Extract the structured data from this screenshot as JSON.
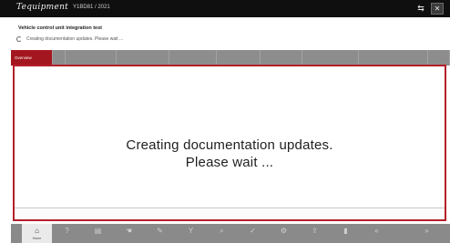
{
  "titlebar": {
    "brand": "Tequipment",
    "vin": "Y1BD81 / 2021",
    "plug_icon": "connector-icon",
    "close_label": "✕"
  },
  "page": {
    "heading": "Vehicle control unit integration test",
    "status_text": "Creating documentation updates. Please wait ..."
  },
  "tabs": [
    {
      "label": "Overview",
      "active": true
    },
    {
      "label": ""
    },
    {
      "label": ""
    },
    {
      "label": ""
    },
    {
      "label": ""
    },
    {
      "label": ""
    },
    {
      "label": ""
    },
    {
      "label": ""
    },
    {
      "label": ""
    },
    {
      "label": ""
    }
  ],
  "main": {
    "message_line1": "Creating documentation updates.",
    "message_line2": "Please wait ..."
  },
  "bottom_toolbar": {
    "items": [
      {
        "icon": "home-icon",
        "label": "Home",
        "active": true
      },
      {
        "icon": "help-icon",
        "label": ""
      },
      {
        "icon": "document-icon",
        "label": ""
      },
      {
        "icon": "hand-icon",
        "label": ""
      },
      {
        "icon": "pencil-icon",
        "label": ""
      },
      {
        "icon": "filter-icon",
        "label": ""
      },
      {
        "icon": "search-icon",
        "label": ""
      },
      {
        "icon": "check-icon",
        "label": ""
      },
      {
        "icon": "gear-icon",
        "label": ""
      },
      {
        "icon": "share-icon",
        "label": ""
      },
      {
        "icon": "print-icon",
        "label": ""
      },
      {
        "icon": "back-icon",
        "label": ""
      },
      {
        "icon": "forward-icon",
        "label": ""
      }
    ]
  },
  "colors": {
    "accent": "#a4161f",
    "titlebar": "#0f0f0f",
    "toolbar": "#8a8a8a"
  }
}
